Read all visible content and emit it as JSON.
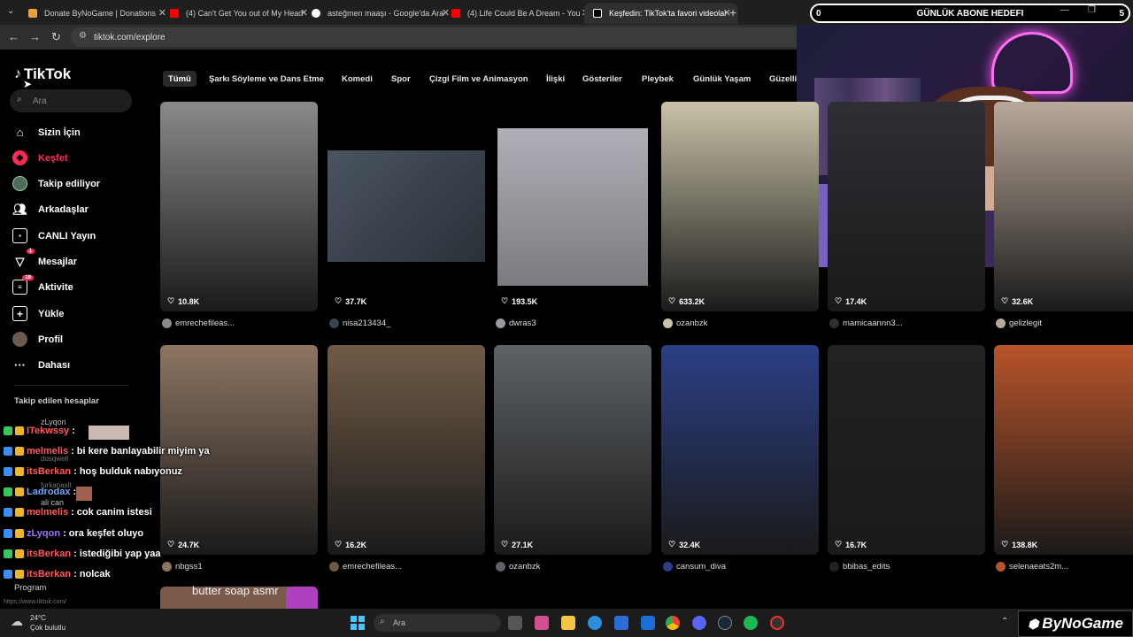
{
  "browser": {
    "tabs": [
      {
        "title": "Donate ByNoGame | Donations"
      },
      {
        "title": "(4) Can't Get You out of My Head"
      },
      {
        "title": "asteğmen maaşı - Google'da Ara"
      },
      {
        "title": "(4) Life Could Be A Dream - You"
      },
      {
        "title": "Keşfedin: TikTok'ta favori videolar"
      }
    ],
    "url": "tiktok.com/explore",
    "status_url": "https://www.tiktok.com/"
  },
  "stream": {
    "goal_count": "0",
    "goal_label": "GÜNLÜK ABONE HEDEFI",
    "goal_target": "5"
  },
  "tiktok": {
    "logo": "TikTok",
    "search_placeholder": "Ara",
    "nav": [
      {
        "label": "Sizin İçin",
        "icon": "home-icon"
      },
      {
        "label": "Keşfet",
        "icon": "compass-icon"
      },
      {
        "label": "Takip ediliyor",
        "icon": "following-avatar"
      },
      {
        "label": "Arkadaşlar",
        "icon": "friends-icon"
      },
      {
        "label": "CANLI Yayın",
        "icon": "live-icon"
      },
      {
        "label": "Mesajlar",
        "icon": "messages-icon",
        "badge": "1"
      },
      {
        "label": "Aktivite",
        "icon": "activity-icon",
        "badge": "19"
      },
      {
        "label": "Yükle",
        "icon": "upload-icon"
      },
      {
        "label": "Profil",
        "icon": "profile-avatar"
      },
      {
        "label": "Dahası",
        "icon": "more-icon"
      }
    ],
    "followed_title": "Takip edilen hesaplar",
    "followed_accounts": [
      "zLyqon",
      "dosqwell",
      "furkanaslt",
      "ali can"
    ],
    "program_label": "Program",
    "categories": [
      "Tümü",
      "Şarkı Söyleme ve Dans Etme",
      "Komedi",
      "Spor",
      "Çizgi Film ve Animasyon",
      "İlişki",
      "Gösteriler",
      "Pleybek",
      "Günlük Yaşam",
      "Güzelli"
    ],
    "videos": [
      {
        "likes": "10.8K",
        "author": "emrechefileas...",
        "color": "#8a8a8a"
      },
      {
        "likes": "37.7K",
        "author": "nisa213434_",
        "color": "#3a4450"
      },
      {
        "likes": "193.5K",
        "author": "dwras3",
        "color": "#9a9aa0"
      },
      {
        "likes": "633.2K",
        "author": "ozanbzk",
        "color": "#c9c2a8"
      },
      {
        "likes": "17.4K",
        "author": "mamicaannn3...",
        "color": "#2e2e34"
      },
      {
        "likes": "32.6K",
        "author": "gelizlegit",
        "color": "#b8a89a"
      },
      {
        "likes": "24.7K",
        "author": "nbgss1",
        "color": "#8d7562"
      },
      {
        "likes": "16.2K",
        "author": "emrechefileas...",
        "color": "#6f5a46"
      },
      {
        "likes": "27.1K",
        "author": "ozanbzk",
        "color": "#5e6266"
      },
      {
        "likes": "32.4K",
        "author": "cansum_diva",
        "color": "#2b3f86"
      },
      {
        "likes": "16.7K",
        "author": "bbibas_edits",
        "color": "#222"
      },
      {
        "likes": "138.8K",
        "author": "selenaeats2m...",
        "color": "#b8542a"
      }
    ],
    "partial_caption": "butter soap asmr"
  },
  "chat": [
    {
      "user": "ITekwssy",
      "msg": "",
      "color": "#ff5a5a"
    },
    {
      "user": "melmelis",
      "msg": "bi kere banlayabilir miyim ya",
      "color": "#ff5a5a"
    },
    {
      "user": "itsBerkan",
      "msg": "hoş bulduk nabıyonuz",
      "color": "#ff5a5a"
    },
    {
      "user": "Ladrodax",
      "msg": "",
      "color": "#6aa8ff"
    },
    {
      "user": "melmelis",
      "msg": "cok canim istesi",
      "color": "#ff5a5a"
    },
    {
      "user": "zLyqon",
      "msg": "ora keşfet oluyo",
      "color": "#a070ff"
    },
    {
      "user": "itsBerkan",
      "msg": "istediğibi yap yaa",
      "color": "#ff5a5a"
    },
    {
      "user": "itsBerkan",
      "msg": "nolcak",
      "color": "#ff5a5a"
    }
  ],
  "taskbar": {
    "weather_temp": "24°C",
    "weather_text": "Çok bulutlu",
    "search_placeholder": "Ara",
    "brand": "ByNoGame"
  }
}
